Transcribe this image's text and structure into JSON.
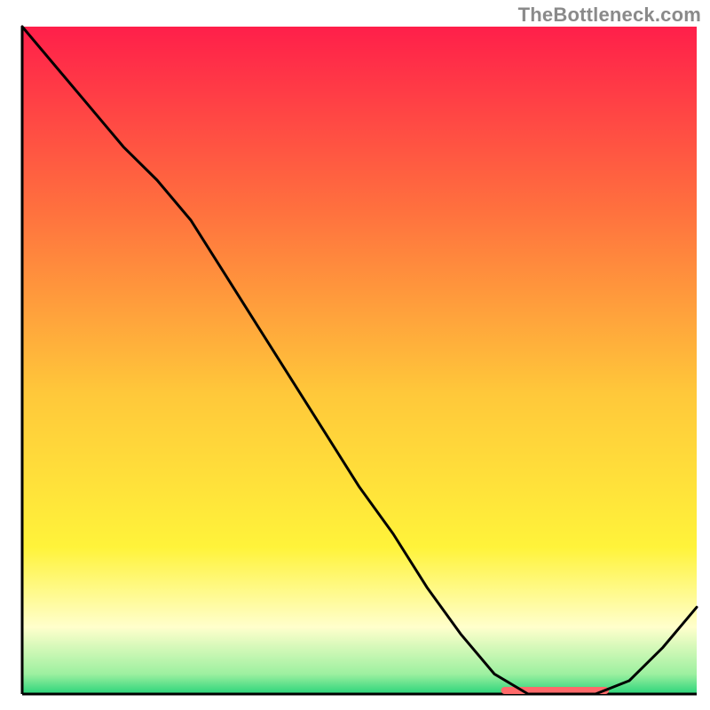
{
  "attribution": "TheBottleneck.com",
  "chart_data": {
    "type": "line",
    "title": "",
    "xlabel": "",
    "ylabel": "",
    "x": [
      0.0,
      0.05,
      0.1,
      0.15,
      0.2,
      0.25,
      0.3,
      0.35,
      0.4,
      0.45,
      0.5,
      0.55,
      0.6,
      0.65,
      0.7,
      0.75,
      0.8,
      0.85,
      0.9,
      0.95,
      1.0
    ],
    "values": [
      1.0,
      0.94,
      0.88,
      0.82,
      0.77,
      0.71,
      0.63,
      0.55,
      0.47,
      0.39,
      0.31,
      0.24,
      0.16,
      0.09,
      0.03,
      0.0,
      0.0,
      0.0,
      0.02,
      0.07,
      0.13
    ],
    "xlim": [
      0,
      1
    ],
    "ylim": [
      0,
      1
    ],
    "background_gradient": {
      "stops": [
        {
          "pos": 0.0,
          "color": "#ff1f4a"
        },
        {
          "pos": 0.28,
          "color": "#ff723e"
        },
        {
          "pos": 0.55,
          "color": "#ffc83a"
        },
        {
          "pos": 0.78,
          "color": "#fff33a"
        },
        {
          "pos": 0.9,
          "color": "#ffffcc"
        },
        {
          "pos": 0.97,
          "color": "#9df0a0"
        },
        {
          "pos": 1.0,
          "color": "#2ad47a"
        }
      ]
    },
    "optimal_marker": {
      "x_start": 0.71,
      "x_end": 0.87,
      "y": 0.0,
      "color": "#ff6a6a"
    }
  }
}
